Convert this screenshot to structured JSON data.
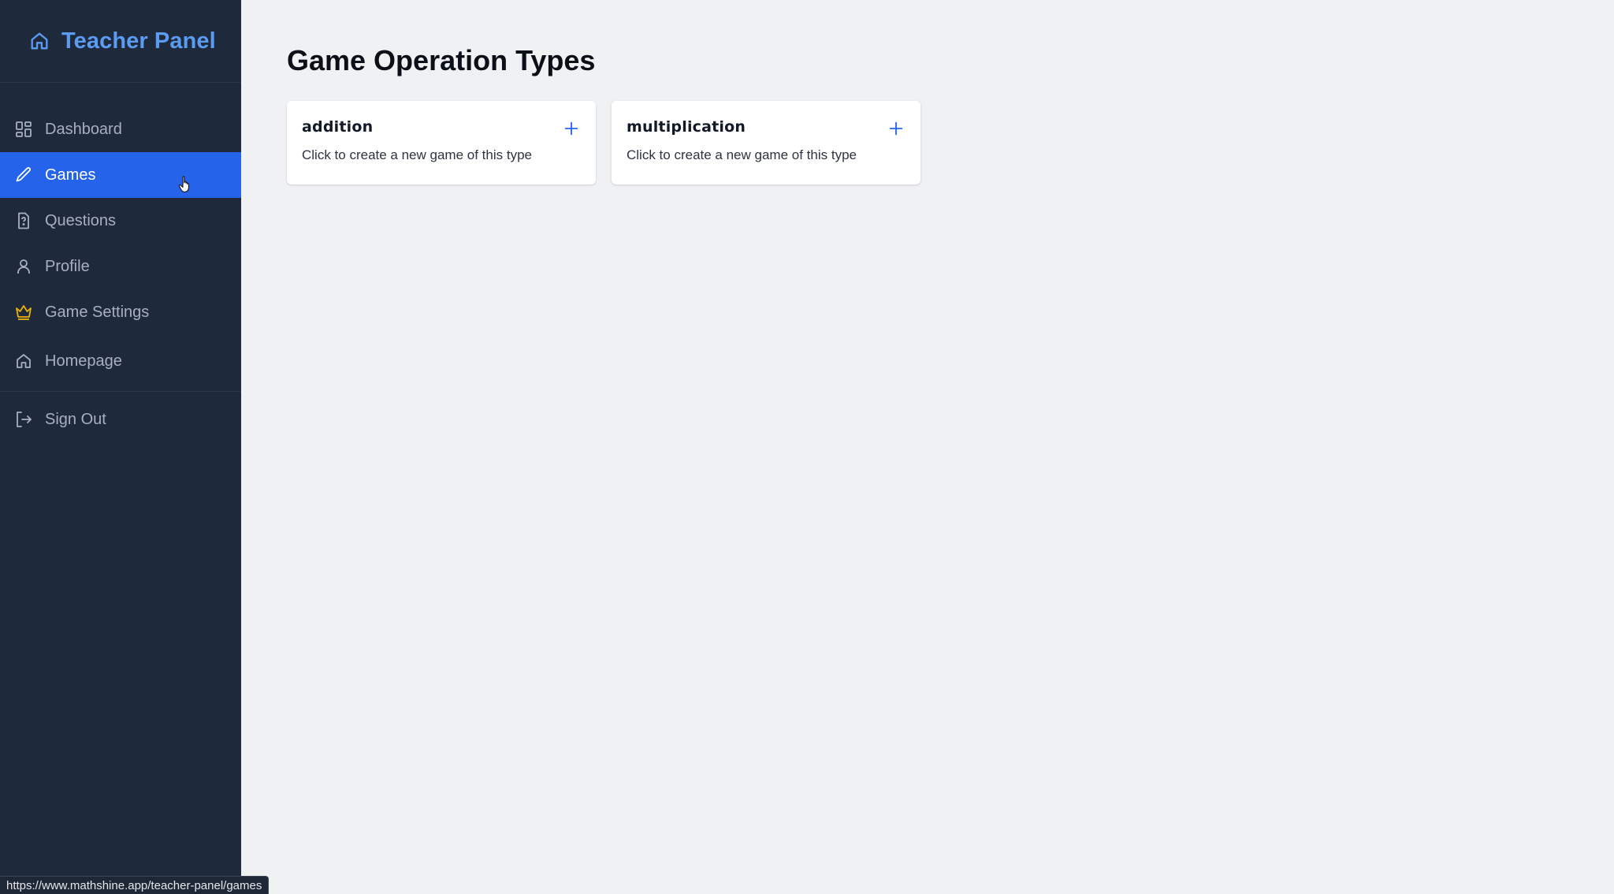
{
  "sidebar": {
    "brand": {
      "title": "Teacher Panel",
      "icon": "home-icon"
    },
    "items": [
      {
        "label": "Dashboard",
        "icon": "dashboard-icon",
        "active": false
      },
      {
        "label": "Games",
        "icon": "pencil-icon",
        "active": true
      },
      {
        "label": "Questions",
        "icon": "question-file-icon",
        "active": false
      },
      {
        "label": "Profile",
        "icon": "user-icon",
        "active": false
      },
      {
        "label": "Game Settings",
        "icon": "crown-icon",
        "active": false
      },
      {
        "label": "Homepage",
        "icon": "home-icon",
        "active": false
      },
      {
        "label": "Sign Out",
        "icon": "sign-out-icon",
        "active": false
      }
    ]
  },
  "main": {
    "title": "Game Operation Types",
    "cards": [
      {
        "title": "addition",
        "description": "Click to create a new game of this type",
        "icon": "plus-icon"
      },
      {
        "title": "multiplication",
        "description": "Click to create a new game of this type",
        "icon": "plus-icon"
      }
    ]
  },
  "status_bar": {
    "url": "https://www.mathshine.app/teacher-panel/games"
  },
  "colors": {
    "sidebar_bg": "#1e293b",
    "active_bg": "#2563eb",
    "brand": "#5b9bf2",
    "crown": "#eab308",
    "page_bg": "#f0f1f3",
    "plus": "#2563eb"
  }
}
